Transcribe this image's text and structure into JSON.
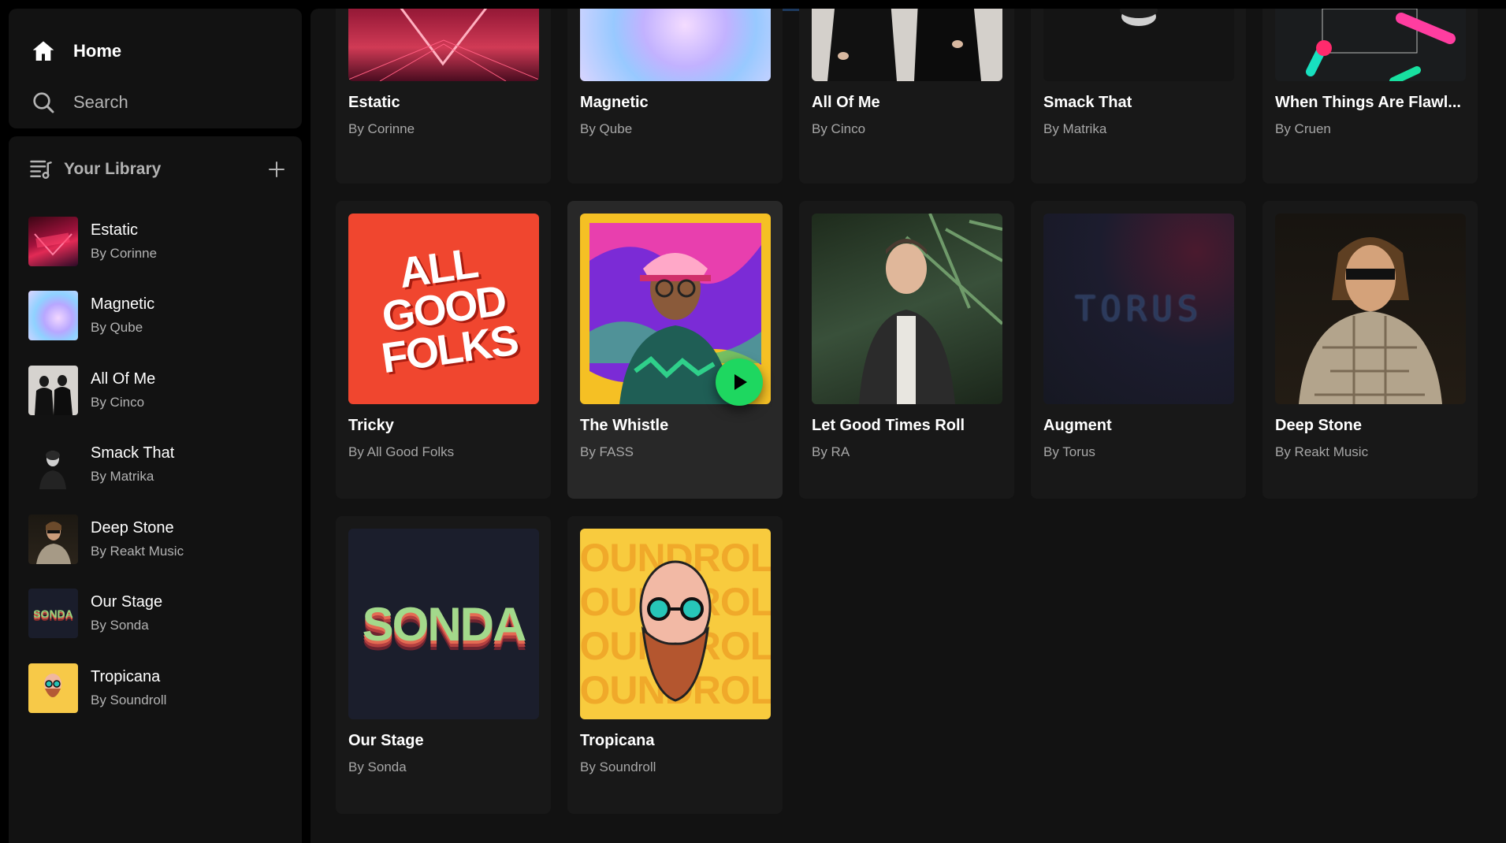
{
  "nav": {
    "home": "Home",
    "search": "Search"
  },
  "library": {
    "title": "Your Library",
    "items": [
      {
        "title": "Estatic",
        "artist": "By Corinne"
      },
      {
        "title": "Magnetic",
        "artist": "By Qube"
      },
      {
        "title": "All Of Me",
        "artist": "By Cinco"
      },
      {
        "title": "Smack That",
        "artist": "By Matrika"
      },
      {
        "title": "Deep Stone",
        "artist": "By Reakt Music"
      },
      {
        "title": "Our Stage",
        "artist": "By Sonda"
      },
      {
        "title": "Tropicana",
        "artist": "By Soundroll"
      }
    ]
  },
  "grid": {
    "cards": [
      {
        "title": "Estatic",
        "artist": "By Corinne"
      },
      {
        "title": "Magnetic",
        "artist": "By Qube"
      },
      {
        "title": "All Of Me",
        "artist": "By Cinco"
      },
      {
        "title": "Smack That",
        "artist": "By Matrika"
      },
      {
        "title": "When Things Are Flawl...",
        "artist": "By Cruen"
      },
      {
        "title": "Tricky",
        "artist": "By All Good Folks"
      },
      {
        "title": "The Whistle",
        "artist": "By FASS"
      },
      {
        "title": "Let Good Times Roll",
        "artist": "By RA"
      },
      {
        "title": "Augment",
        "artist": "By Torus"
      },
      {
        "title": "Deep Stone",
        "artist": "By Reakt Music"
      },
      {
        "title": "Our Stage",
        "artist": "By Sonda"
      },
      {
        "title": "Tropicana",
        "artist": "By Soundroll"
      }
    ]
  },
  "cover_text": {
    "tricky": "ALL GOOD FOLKS",
    "torus": "TORUS",
    "sonda": "SONDA",
    "soundroll": "SOUNDROLL"
  },
  "colors": {
    "accent": "#1ed760",
    "background": "#000000",
    "panel": "#121212",
    "card": "#181818"
  }
}
